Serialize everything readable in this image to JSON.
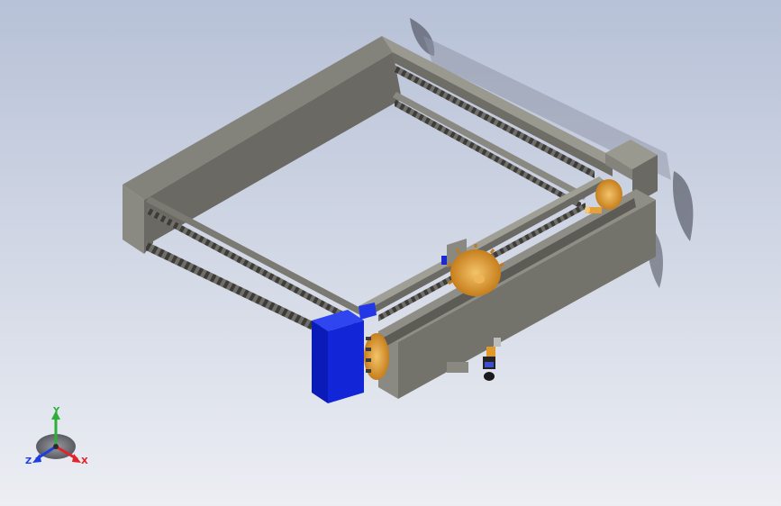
{
  "viewport": {
    "background_top": "#b9c2d8",
    "background_bottom": "#e8eaf0",
    "model_gray": "#7f7e76",
    "model_gray_dark": "#5c5b55",
    "motor_blue": "#1226d8",
    "gear_orange": "#e09a2c"
  },
  "triad": {
    "x_label": "X",
    "y_label": "Y",
    "z_label": "Z",
    "x_color": "#e0242a",
    "y_color": "#2fae3a",
    "z_color": "#1d3fe0"
  }
}
